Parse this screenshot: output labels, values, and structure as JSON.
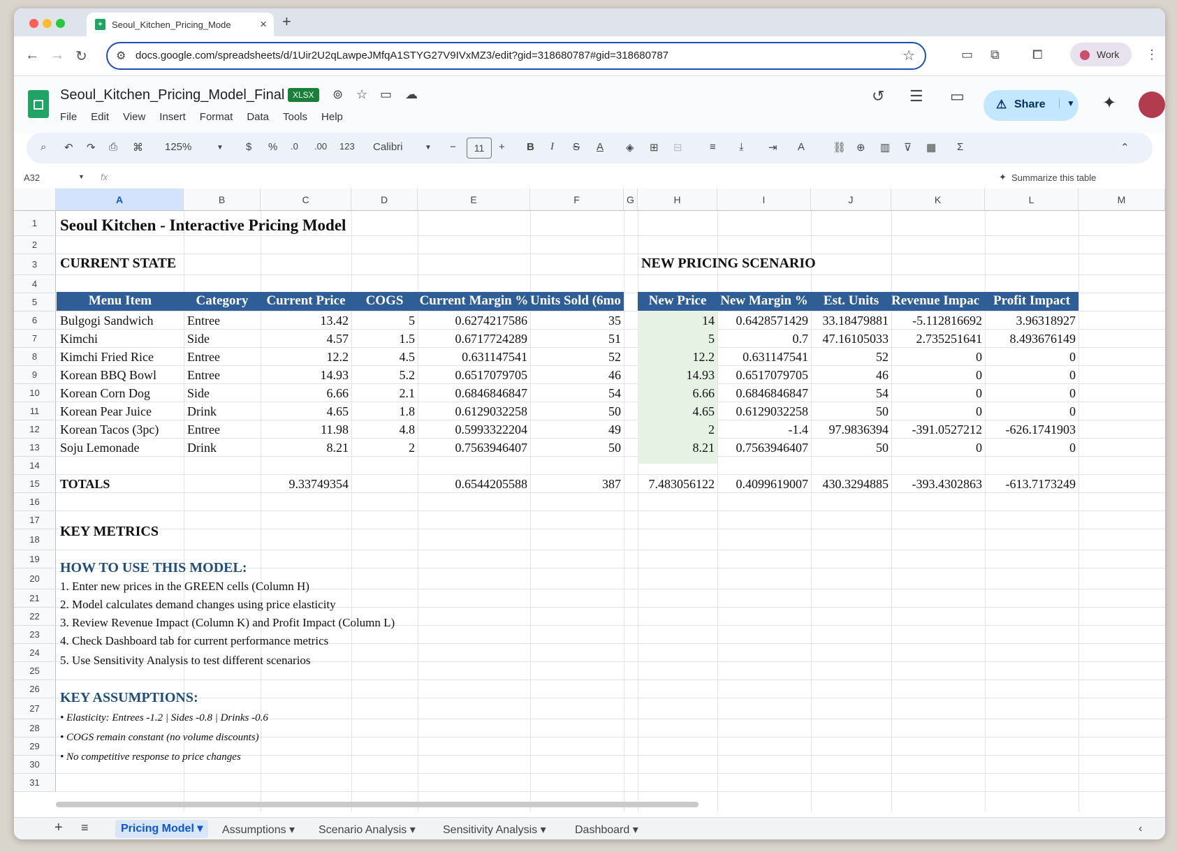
{
  "browser": {
    "tab_title": "Seoul_Kitchen_Pricing_Mode",
    "url": "docs.google.com/spreadsheets/d/1Uir2U2qLawpeJMfqA1STYG27V9IVxMZ3/edit?gid=318680787#gid=318680787",
    "profile": "Work"
  },
  "doc": {
    "title": "Seoul_Kitchen_Pricing_Model_Final",
    "badge": "XLSX",
    "menu": [
      "File",
      "Edit",
      "View",
      "Insert",
      "Format",
      "Data",
      "Tools",
      "Help"
    ],
    "share_label": "Share"
  },
  "toolbar": {
    "zoom": "125%",
    "currency": "$",
    "percent": "%",
    "dec_dec": ".0",
    "dec_inc": ".00",
    "number_format": "123",
    "font": "Calibri",
    "font_size": "11",
    "bold": "B",
    "italic": "I",
    "sigma": "Σ"
  },
  "formula_bar": {
    "cell_ref": "A32",
    "fx": "fx",
    "summarize": "Summarize this table"
  },
  "columns": [
    "A",
    "B",
    "C",
    "D",
    "E",
    "F",
    "G",
    "H",
    "I",
    "J",
    "K",
    "L",
    "M"
  ],
  "rows": [
    "1",
    "2",
    "3",
    "4",
    "5",
    "6",
    "7",
    "8",
    "9",
    "10",
    "11",
    "12",
    "13",
    "14",
    "15",
    "16",
    "17",
    "18",
    "19",
    "20",
    "21",
    "22",
    "23",
    "24",
    "25",
    "26",
    "27",
    "28",
    "29",
    "30",
    "31"
  ],
  "sheet": {
    "title": "Seoul Kitchen - Interactive Pricing Model",
    "current_state": "CURRENT STATE",
    "new_pricing": "NEW PRICING SCENARIO",
    "headers_left": [
      "Menu Item",
      "Category",
      "Current Price",
      "COGS",
      "Current Margin %",
      "Units Sold (6mo"
    ],
    "headers_right": [
      "New Price",
      "New Margin %",
      "Est. Units",
      "Revenue Impac",
      "Profit Impact"
    ],
    "data": [
      [
        "Bulgogi Sandwich",
        "Entree",
        "13.42",
        "5",
        "0.6274217586",
        "35",
        "14",
        "0.6428571429",
        "33.18479881",
        "-5.112816692",
        "3.96318927"
      ],
      [
        "Kimchi",
        "Side",
        "4.57",
        "1.5",
        "0.6717724289",
        "51",
        "5",
        "0.7",
        "47.16105033",
        "2.735251641",
        "8.493676149"
      ],
      [
        "Kimchi Fried Rice",
        "Entree",
        "12.2",
        "4.5",
        "0.631147541",
        "52",
        "12.2",
        "0.631147541",
        "52",
        "0",
        "0"
      ],
      [
        "Korean BBQ Bowl",
        "Entree",
        "14.93",
        "5.2",
        "0.6517079705",
        "46",
        "14.93",
        "0.6517079705",
        "46",
        "0",
        "0"
      ],
      [
        "Korean Corn Dog",
        "Side",
        "6.66",
        "2.1",
        "0.6846846847",
        "54",
        "6.66",
        "0.6846846847",
        "54",
        "0",
        "0"
      ],
      [
        "Korean Pear Juice",
        "Drink",
        "4.65",
        "1.8",
        "0.6129032258",
        "50",
        "4.65",
        "0.6129032258",
        "50",
        "0",
        "0"
      ],
      [
        "Korean Tacos (3pc)",
        "Entree",
        "11.98",
        "4.8",
        "0.5993322204",
        "49",
        "2",
        "-1.4",
        "97.9836394",
        "-391.0527212",
        "-626.1741903"
      ],
      [
        "Soju Lemonade",
        "Drink",
        "8.21",
        "2",
        "0.7563946407",
        "50",
        "8.21",
        "0.7563946407",
        "50",
        "0",
        "0"
      ]
    ],
    "totals": [
      "TOTALS",
      "",
      "9.33749354",
      "",
      "0.6544205588",
      "387",
      "7.483056122",
      "0.4099619007",
      "430.3294885",
      "-393.4302863",
      "-613.7173249"
    ],
    "key_metrics": "KEY METRICS",
    "how_to": "HOW TO USE THIS MODEL:",
    "steps": [
      "1. Enter new prices in the GREEN cells (Column H)",
      "2. Model calculates demand changes using price elasticity",
      "3. Review Revenue Impact (Column K) and Profit Impact (Column L)",
      "4. Check Dashboard tab for current performance metrics",
      "5. Use Sensitivity Analysis to test different scenarios"
    ],
    "assumptions_title": "KEY ASSUMPTIONS:",
    "assumptions": [
      "• Elasticity: Entrees -1.2 | Sides -0.8 | Drinks -0.6",
      "• COGS remain constant (no volume discounts)",
      "• No competitive response to price changes"
    ]
  },
  "tabs": [
    "Pricing Model",
    "Assumptions",
    "Scenario Analysis",
    "Sensitivity Analysis",
    "Dashboard"
  ],
  "colors": {
    "header_band": "#2e5e95",
    "input_green": "#e6f2e3",
    "section_blue": "#1f4e79",
    "share_bg": "#c2e7ff"
  }
}
